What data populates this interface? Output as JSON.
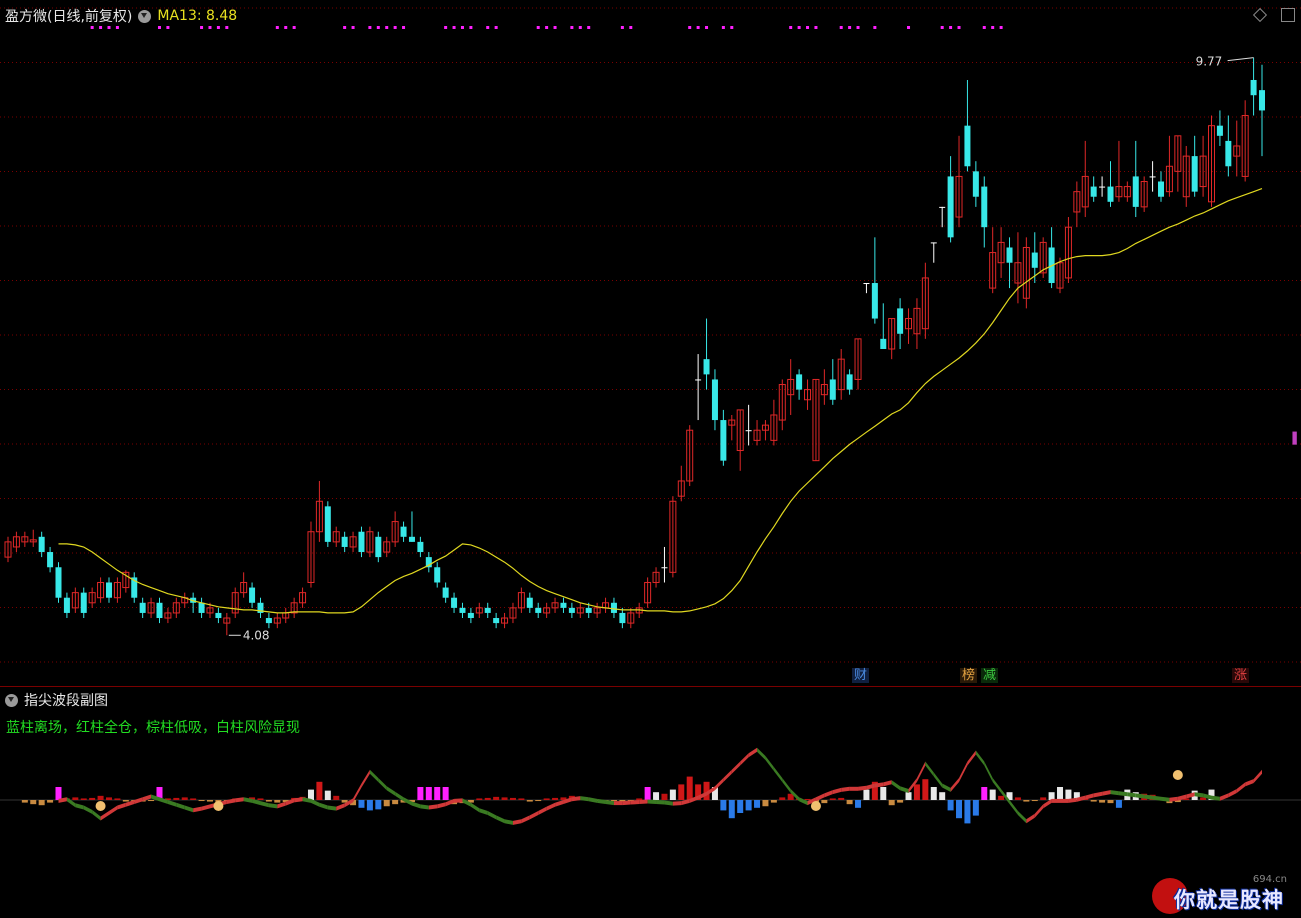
{
  "header": {
    "stock_title": "盈方微(日线,前复权)",
    "ma_label": "MA13: 8.48"
  },
  "price_chart": {
    "ylim": [
      3.6,
      10.2
    ],
    "high_marker": "9.77",
    "low_marker": "4.08",
    "tags": [
      {
        "text": "财",
        "color": "#4a8adf"
      },
      {
        "text": "榜",
        "color": "#e0a040"
      },
      {
        "text": "减",
        "color": "#3cc840"
      },
      {
        "text": "涨",
        "color": "#e04040"
      }
    ]
  },
  "sub_chart": {
    "title": "指尖波段副图",
    "legend": "蓝柱离场，红柱全仓，棕柱低吸，白柱风险显现"
  },
  "watermark": {
    "text": "你就是股神",
    "site": "694.cn"
  },
  "colors": {
    "up": "#e02828",
    "down": "#38e8e8",
    "ma": "#e0d820",
    "grid": "#7a0000",
    "magenta": "#ff20ff"
  },
  "chart_data": {
    "type": "candlestick",
    "title": "",
    "candles": [
      [
        4.85,
        5.0,
        4.8,
        5.05
      ],
      [
        4.95,
        5.05,
        4.9,
        5.1
      ],
      [
        5.0,
        5.05,
        4.95,
        5.1
      ],
      [
        5.0,
        5.02,
        4.95,
        5.12
      ],
      [
        5.05,
        4.9,
        4.85,
        5.1
      ],
      [
        4.9,
        4.75,
        4.7,
        4.95
      ],
      [
        4.75,
        4.45,
        4.4,
        4.8
      ],
      [
        4.45,
        4.3,
        4.25,
        4.5
      ],
      [
        4.35,
        4.5,
        4.3,
        4.55
      ],
      [
        4.5,
        4.3,
        4.25,
        4.55
      ],
      [
        4.4,
        4.5,
        4.35,
        4.55
      ],
      [
        4.45,
        4.6,
        4.4,
        4.65
      ],
      [
        4.6,
        4.45,
        4.4,
        4.65
      ],
      [
        4.45,
        4.6,
        4.4,
        4.65
      ],
      [
        4.55,
        4.7,
        4.5,
        4.72
      ],
      [
        4.65,
        4.45,
        4.4,
        4.7
      ],
      [
        4.4,
        4.3,
        4.25,
        4.45
      ],
      [
        4.3,
        4.4,
        4.25,
        4.45
      ],
      [
        4.4,
        4.25,
        4.2,
        4.45
      ],
      [
        4.25,
        4.3,
        4.2,
        4.35
      ],
      [
        4.3,
        4.4,
        4.25,
        4.45
      ],
      [
        4.4,
        4.45,
        4.35,
        4.5
      ],
      [
        4.45,
        4.4,
        4.3,
        4.5
      ],
      [
        4.4,
        4.3,
        4.25,
        4.45
      ],
      [
        4.3,
        4.35,
        4.25,
        4.4
      ],
      [
        4.3,
        4.25,
        4.2,
        4.35
      ],
      [
        4.2,
        4.25,
        4.08,
        4.3
      ],
      [
        4.3,
        4.5,
        4.25,
        4.55
      ],
      [
        4.5,
        4.6,
        4.45,
        4.7
      ],
      [
        4.55,
        4.4,
        4.35,
        4.6
      ],
      [
        4.4,
        4.3,
        4.25,
        4.45
      ],
      [
        4.25,
        4.2,
        4.15,
        4.3
      ],
      [
        4.2,
        4.25,
        4.15,
        4.3
      ],
      [
        4.25,
        4.3,
        4.2,
        4.35
      ],
      [
        4.3,
        4.4,
        4.25,
        4.45
      ],
      [
        4.4,
        4.5,
        4.35,
        4.55
      ],
      [
        4.6,
        5.1,
        4.55,
        5.2
      ],
      [
        5.1,
        5.4,
        5.0,
        5.6
      ],
      [
        5.35,
        5.0,
        4.95,
        5.4
      ],
      [
        5.0,
        5.1,
        4.95,
        5.15
      ],
      [
        5.05,
        4.95,
        4.9,
        5.1
      ],
      [
        4.95,
        5.05,
        4.9,
        5.1
      ],
      [
        5.1,
        4.9,
        4.85,
        5.15
      ],
      [
        4.9,
        5.1,
        4.85,
        5.15
      ],
      [
        5.05,
        4.85,
        4.8,
        5.1
      ],
      [
        4.9,
        5.0,
        4.85,
        5.05
      ],
      [
        5.0,
        5.2,
        4.95,
        5.3
      ],
      [
        5.15,
        5.05,
        5.0,
        5.2
      ],
      [
        5.05,
        5.0,
        5.0,
        5.3
      ],
      [
        5.0,
        4.9,
        4.85,
        5.05
      ],
      [
        4.85,
        4.75,
        4.7,
        4.9
      ],
      [
        4.75,
        4.6,
        4.55,
        4.8
      ],
      [
        4.55,
        4.45,
        4.4,
        4.6
      ],
      [
        4.45,
        4.35,
        4.3,
        4.5
      ],
      [
        4.35,
        4.3,
        4.25,
        4.4
      ],
      [
        4.3,
        4.25,
        4.2,
        4.35
      ],
      [
        4.3,
        4.35,
        4.25,
        4.4
      ],
      [
        4.35,
        4.3,
        4.25,
        4.4
      ],
      [
        4.25,
        4.2,
        4.15,
        4.3
      ],
      [
        4.2,
        4.25,
        4.15,
        4.3
      ],
      [
        4.25,
        4.35,
        4.2,
        4.4
      ],
      [
        4.35,
        4.5,
        4.3,
        4.55
      ],
      [
        4.45,
        4.35,
        4.3,
        4.5
      ],
      [
        4.35,
        4.3,
        4.25,
        4.4
      ],
      [
        4.3,
        4.35,
        4.25,
        4.4
      ],
      [
        4.35,
        4.4,
        4.3,
        4.45
      ],
      [
        4.4,
        4.35,
        4.3,
        4.45
      ],
      [
        4.35,
        4.3,
        4.25,
        4.4
      ],
      [
        4.3,
        4.35,
        4.25,
        4.4
      ],
      [
        4.35,
        4.3,
        4.25,
        4.4
      ],
      [
        4.3,
        4.35,
        4.25,
        4.4
      ],
      [
        4.35,
        4.4,
        4.3,
        4.45
      ],
      [
        4.4,
        4.3,
        4.25,
        4.45
      ],
      [
        4.3,
        4.2,
        4.15,
        4.35
      ],
      [
        4.2,
        4.3,
        4.15,
        4.35
      ],
      [
        4.3,
        4.35,
        4.25,
        4.4
      ],
      [
        4.4,
        4.6,
        4.35,
        4.65
      ],
      [
        4.6,
        4.7,
        4.55,
        4.75
      ],
      [
        4.75,
        4.75,
        4.6,
        4.95
      ],
      [
        4.7,
        5.4,
        4.65,
        5.45
      ],
      [
        5.45,
        5.6,
        5.4,
        5.75
      ],
      [
        5.6,
        6.1,
        5.55,
        6.15
      ],
      [
        6.6,
        6.6,
        6.2,
        6.85
      ],
      [
        6.8,
        6.65,
        6.5,
        7.2
      ],
      [
        6.6,
        6.2,
        6.1,
        6.7
      ],
      [
        6.2,
        5.8,
        5.75,
        6.3
      ],
      [
        6.15,
        6.2,
        6.0,
        6.25
      ],
      [
        5.9,
        6.3,
        5.7,
        6.3
      ],
      [
        6.1,
        6.1,
        5.95,
        6.35
      ],
      [
        6.0,
        6.1,
        5.95,
        6.2
      ],
      [
        6.1,
        6.15,
        6.0,
        6.2
      ],
      [
        6.0,
        6.25,
        5.95,
        6.4
      ],
      [
        6.2,
        6.55,
        6.1,
        6.6
      ],
      [
        6.45,
        6.6,
        6.25,
        6.8
      ],
      [
        6.65,
        6.5,
        6.4,
        6.7
      ],
      [
        6.4,
        6.5,
        6.3,
        6.6
      ],
      [
        5.8,
        6.6,
        5.8,
        6.6
      ],
      [
        6.45,
        6.55,
        6.35,
        6.7
      ],
      [
        6.6,
        6.4,
        6.35,
        6.8
      ],
      [
        6.5,
        6.8,
        6.4,
        6.9
      ],
      [
        6.65,
        6.5,
        6.45,
        6.7
      ],
      [
        6.6,
        7.0,
        6.5,
        7.0
      ],
      [
        7.55,
        7.55,
        7.45,
        7.55
      ],
      [
        7.55,
        7.2,
        7.15,
        8.0
      ],
      [
        7.0,
        6.9,
        6.9,
        7.35
      ],
      [
        6.9,
        7.2,
        6.8,
        7.2
      ],
      [
        7.3,
        7.05,
        6.9,
        7.4
      ],
      [
        7.1,
        7.2,
        6.95,
        7.3
      ],
      [
        7.05,
        7.3,
        6.9,
        7.4
      ],
      [
        7.1,
        7.6,
        7.0,
        7.75
      ],
      [
        7.95,
        7.95,
        7.75,
        7.95
      ],
      [
        8.3,
        8.3,
        8.1,
        8.3
      ],
      [
        8.6,
        8.0,
        7.95,
        8.8
      ],
      [
        8.2,
        8.6,
        8.1,
        9.0
      ],
      [
        9.1,
        8.7,
        8.65,
        9.55
      ],
      [
        8.65,
        8.4,
        8.3,
        8.75
      ],
      [
        8.5,
        8.1,
        7.9,
        8.6
      ],
      [
        7.5,
        7.85,
        7.45,
        8.1
      ],
      [
        7.75,
        7.95,
        7.6,
        8.1
      ],
      [
        7.9,
        7.75,
        7.5,
        8.0
      ],
      [
        7.55,
        7.75,
        7.35,
        8.05
      ],
      [
        7.4,
        7.9,
        7.3,
        8.0
      ],
      [
        7.85,
        7.7,
        7.55,
        8.05
      ],
      [
        7.65,
        7.95,
        7.6,
        8.0
      ],
      [
        7.9,
        7.55,
        7.5,
        8.1
      ],
      [
        7.5,
        7.75,
        7.45,
        7.8
      ],
      [
        7.6,
        8.1,
        7.55,
        8.2
      ],
      [
        8.25,
        8.45,
        8.1,
        8.55
      ],
      [
        8.3,
        8.6,
        8.2,
        8.95
      ],
      [
        8.5,
        8.4,
        8.35,
        8.6
      ],
      [
        8.5,
        8.5,
        8.4,
        8.6
      ],
      [
        8.5,
        8.35,
        8.3,
        8.75
      ],
      [
        8.4,
        8.5,
        8.35,
        8.95
      ],
      [
        8.4,
        8.5,
        8.35,
        8.55
      ],
      [
        8.6,
        8.3,
        8.2,
        8.95
      ],
      [
        8.3,
        8.55,
        8.25,
        8.6
      ],
      [
        8.6,
        8.6,
        8.45,
        8.75
      ],
      [
        8.55,
        8.4,
        8.35,
        8.65
      ],
      [
        8.45,
        8.7,
        8.4,
        9.0
      ],
      [
        8.65,
        9.0,
        8.45,
        9.0
      ],
      [
        8.4,
        8.8,
        8.3,
        8.9
      ],
      [
        8.8,
        8.45,
        8.4,
        9.0
      ],
      [
        8.5,
        8.8,
        8.4,
        9.0
      ],
      [
        8.35,
        9.1,
        8.3,
        9.2
      ],
      [
        9.1,
        9.0,
        8.9,
        9.25
      ],
      [
        8.95,
        8.7,
        8.6,
        9.2
      ],
      [
        8.8,
        8.9,
        8.6,
        9.15
      ],
      [
        8.6,
        9.2,
        8.55,
        9.35
      ],
      [
        9.55,
        9.4,
        9.2,
        9.77
      ],
      [
        9.45,
        9.25,
        8.8,
        9.7
      ]
    ],
    "ma13": [
      4.98,
      4.98,
      4.97,
      4.95,
      4.9,
      4.84,
      4.78,
      4.72,
      4.67,
      4.62,
      4.58,
      4.55,
      4.52,
      4.49,
      4.47,
      4.45,
      4.42,
      4.4,
      4.38,
      4.36,
      4.35,
      4.34,
      4.33,
      4.33,
      4.32,
      4.31,
      4.3,
      4.3,
      4.31,
      4.31,
      4.31,
      4.31,
      4.3,
      4.3,
      4.3,
      4.31,
      4.36,
      4.43,
      4.5,
      4.56,
      4.62,
      4.66,
      4.69,
      4.73,
      4.77,
      4.82,
      4.86,
      4.92,
      4.98,
      4.97,
      4.94,
      4.9,
      4.85,
      4.8,
      4.74,
      4.67,
      4.61,
      4.56,
      4.52,
      4.49,
      4.46,
      4.43,
      4.4,
      4.38,
      4.36,
      4.35,
      4.34,
      4.33,
      4.33,
      4.33,
      4.32,
      4.32,
      4.32,
      4.31,
      4.31,
      4.32,
      4.34,
      4.36,
      4.39,
      4.44,
      4.52,
      4.62,
      4.76,
      4.9,
      5.03,
      5.15,
      5.28,
      5.4,
      5.5,
      5.58,
      5.66,
      5.74,
      5.82,
      5.89,
      5.96,
      6.02,
      6.08,
      6.14,
      6.2,
      6.26,
      6.3,
      6.37,
      6.47,
      6.56,
      6.63,
      6.69,
      6.75,
      6.81,
      6.88,
      6.96,
      7.05,
      7.16,
      7.28,
      7.4,
      7.5,
      7.56,
      7.62,
      7.68,
      7.72,
      7.76,
      7.79,
      7.81,
      7.82,
      7.82,
      7.82,
      7.83,
      7.85,
      7.89,
      7.94,
      7.98,
      8.02,
      8.06,
      8.1,
      8.13,
      8.17,
      8.21,
      8.24,
      8.28,
      8.32,
      8.36,
      8.39,
      8.42,
      8.45,
      8.48
    ],
    "sub_line": [
      0.2,
      0.5,
      -0.6,
      -1.0,
      -1.8,
      -3.0,
      -2.0,
      -1.0,
      -0.5,
      0.0,
      0.5,
      1.0,
      0.5,
      0.0,
      -0.5,
      -1.0,
      -1.5,
      -1.2,
      -0.8,
      -0.4,
      0.0,
      0.3,
      0.5,
      0.2,
      -0.2,
      -0.6,
      -0.8,
      -0.3,
      0.3,
      0.5,
      0.2,
      -0.5,
      -1.0,
      -1.2,
      -0.6,
      0.3,
      3.0,
      5.5,
      4.0,
      2.5,
      1.5,
      0.5,
      -0.3,
      -0.8,
      -1.0,
      -0.8,
      -0.4,
      0.2,
      0.3,
      -0.5,
      -1.5,
      -2.0,
      -2.8,
      -3.5,
      -3.8,
      -3.5,
      -2.8,
      -2.0,
      -1.2,
      -0.5,
      0.0,
      0.5,
      0.7,
      0.5,
      0.2,
      0.0,
      -0.2,
      -0.2,
      -0.1,
      0.0,
      0.1,
      0.0,
      -0.1,
      -0.3,
      -0.2,
      0.2,
      0.8,
      1.5,
      2.5,
      4.0,
      5.5,
      7.0,
      8.5,
      9.5,
      8.0,
      6.0,
      4.0,
      2.0,
      0.5,
      -0.2,
      0.5,
      1.2,
      1.8,
      2.2,
      2.4,
      2.4,
      2.6,
      3.0,
      3.2,
      3.6,
      2.5,
      2.0,
      4.0,
      7.0,
      5.0,
      3.0,
      2.2,
      4.0,
      7.0,
      9.0,
      7.0,
      4.0,
      2.0,
      0.0,
      -2.0,
      -3.5,
      -2.5,
      -0.8,
      0.2,
      0.2,
      0.2,
      0.4,
      0.8,
      1.2,
      1.5,
      1.8,
      1.6,
      1.4,
      1.2,
      1.0,
      0.8,
      0.6,
      0.4,
      0.6,
      1.0,
      1.4,
      1.2,
      0.8,
      0.6,
      1.2,
      2.0,
      3.2,
      3.8,
      5.5
    ],
    "sub_bars": [
      0,
      0,
      -0.5,
      -0.8,
      -1.0,
      -0.5,
      2.5,
      0.3,
      0.5,
      0.3,
      0.4,
      0.8,
      0.5,
      0.3,
      -0.3,
      -0.4,
      -0.3,
      -0.2,
      2.5,
      0.3,
      0.4,
      0.5,
      0.3,
      -0.2,
      -0.3,
      -0.4,
      -0.2,
      0.3,
      0.4,
      0.5,
      0.3,
      -0.3,
      -0.5,
      -0.4,
      0.4,
      0.6,
      2.0,
      3.5,
      1.8,
      0.8,
      -0.5,
      -1.0,
      -1.5,
      -2.0,
      -1.8,
      -1.2,
      -0.8,
      -0.5,
      -0.4,
      2.5,
      2.5,
      2.5,
      2.5,
      -0.8,
      -0.6,
      -0.5,
      0.3,
      0.4,
      0.6,
      0.5,
      0.4,
      0.3,
      -0.3,
      -0.2,
      0.3,
      0.4,
      0.5,
      0.8,
      0.6,
      0.3,
      -0.2,
      -0.3,
      -0.2,
      -0.3,
      -0.2,
      0.3,
      2.5,
      1.5,
      1.2,
      2.0,
      3.0,
      4.5,
      3.0,
      3.5,
      2.5,
      -2.0,
      -3.5,
      -2.5,
      -2.0,
      -1.5,
      -1.2,
      -0.5,
      0.5,
      1.2,
      0.3,
      0.2,
      -0.4,
      -0.6,
      0.3,
      0.4,
      -0.8,
      -1.5,
      2.0,
      3.5,
      2.5,
      -1.0,
      -0.5,
      1.5,
      3.0,
      4.0,
      2.5,
      1.5,
      -2.0,
      -3.5,
      -4.5,
      -3.0,
      2.5,
      2.0,
      0.8,
      1.5,
      0.5,
      -0.3,
      -0.2,
      0.5,
      1.5,
      2.5,
      2.0,
      1.5,
      0.5,
      -0.3,
      -0.5,
      -0.6,
      -1.5,
      2.0,
      1.5,
      1.2,
      1.0,
      0.5,
      -0.6,
      -0.4,
      0.3,
      1.8,
      0.5,
      2.0
    ]
  }
}
